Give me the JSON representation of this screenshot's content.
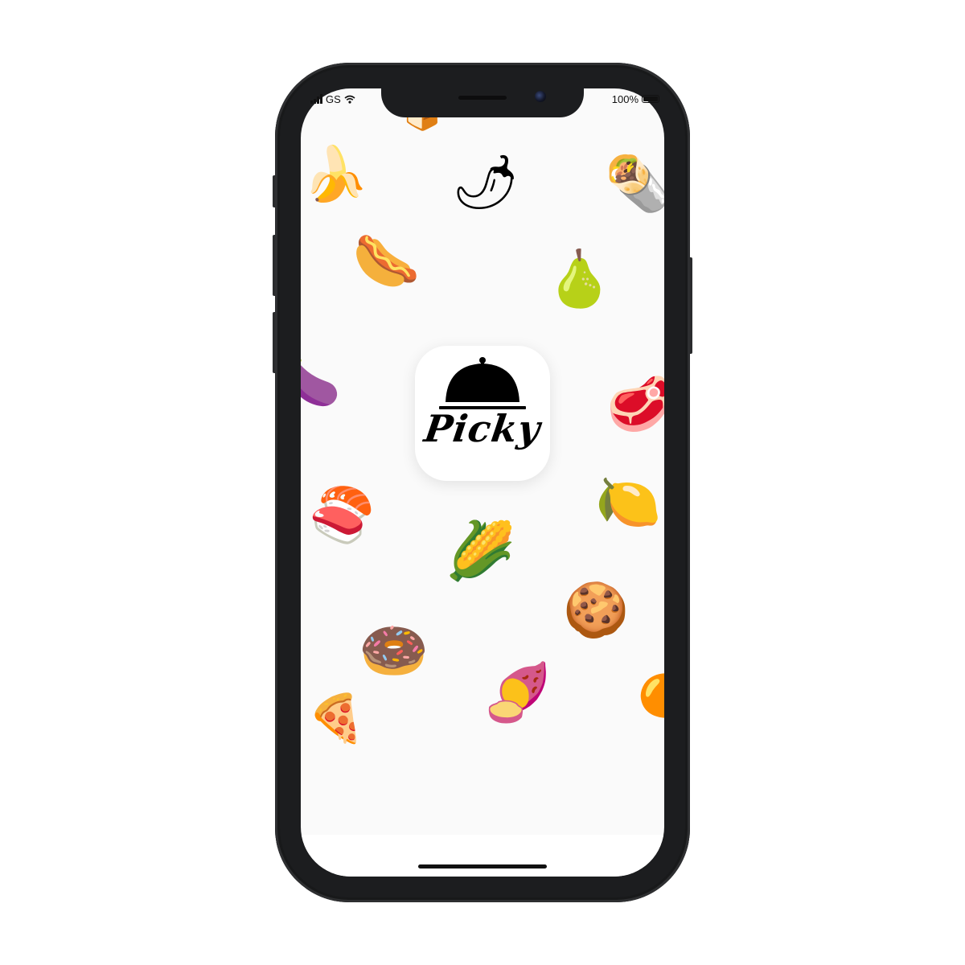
{
  "status_bar": {
    "carrier": "GS",
    "battery_percent": "100%",
    "battery_level": 1.0
  },
  "app": {
    "name": "Picky",
    "icon": "cloche-icon"
  },
  "colors": {
    "phone_frame": "#1c1d1f",
    "screen_background": "#fafafa",
    "icon_ink": "#000000"
  },
  "food_items": [
    {
      "name": "bread-icon",
      "glyph": "🍞"
    },
    {
      "name": "banana-icon",
      "glyph": "🍌"
    },
    {
      "name": "hot-pepper-icon",
      "glyph": "🌶"
    },
    {
      "name": "burrito-icon",
      "glyph": "🌯"
    },
    {
      "name": "hot-dog-icon",
      "glyph": "🌭"
    },
    {
      "name": "pear-icon",
      "glyph": "🍐"
    },
    {
      "name": "eggplant-icon",
      "glyph": "🍆"
    },
    {
      "name": "meat-icon",
      "glyph": "🥩"
    },
    {
      "name": "sushi-icon",
      "glyph": "🍣"
    },
    {
      "name": "lemon-icon",
      "glyph": "🍋"
    },
    {
      "name": "corn-icon",
      "glyph": "🌽"
    },
    {
      "name": "cookie-icon",
      "glyph": "🍪"
    },
    {
      "name": "donut-icon",
      "glyph": "🍩"
    },
    {
      "name": "sweet-potato-icon",
      "glyph": "🍠"
    },
    {
      "name": "orange-icon",
      "glyph": "🍊"
    },
    {
      "name": "pizza-icon",
      "glyph": "🍕"
    }
  ]
}
